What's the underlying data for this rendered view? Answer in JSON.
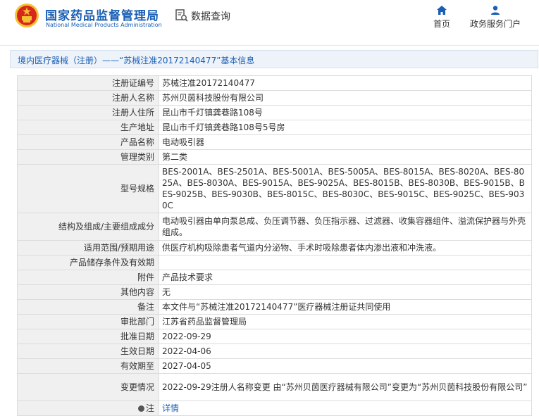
{
  "header": {
    "brand_cn": "国家药品监督管理局",
    "brand_en": "National Medical Products Administration",
    "query_label": "数据查询",
    "nav": {
      "home_label": "首页",
      "portal_label": "政务服务门户"
    }
  },
  "breadcrumb": {
    "text": "境内医疗器械（注册）——“苏械注准20172140477”基本信息"
  },
  "colors": {
    "brand_blue": "#1a5fb4",
    "label_bg": "#f0f0f0",
    "breadcrumb_bg": "#eef3fa",
    "emblem_red": "#d7261e",
    "emblem_gold": "#f2c230"
  },
  "icons": {
    "logo": "national-emblem-icon",
    "query": "document-search-icon",
    "home": "home-icon",
    "portal": "user-icon",
    "note": "info-dot-icon"
  },
  "table": {
    "rows": [
      {
        "label": "注册证编号",
        "value": "苏械注准20172140477"
      },
      {
        "label": "注册人名称",
        "value": "苏州贝茵科技股份有限公司"
      },
      {
        "label": "注册人住所",
        "value": "昆山市千灯镇龚巷路108号"
      },
      {
        "label": "生产地址",
        "value": "昆山市千灯镇龚巷路108号5号房"
      },
      {
        "label": "产品名称",
        "value": "电动吸引器"
      },
      {
        "label": "管理类别",
        "value": "第二类"
      },
      {
        "label": "型号规格",
        "value": "BES-2001A、BES-2501A、BES-5001A、BES-5005A、BES-8015A、BES-8020A、BES-8025A、BES-8030A、BES-9015A、BES-9025A、BES-8015B、BES-8030B、BES-9015B、BES-9025B、BES-9030B、BES-8015C、BES-8030C、BES-9015C、BES-9025C、BES-9030C"
      },
      {
        "label": "结构及组成/主要组成成分",
        "value": "电动吸引器由单向泵总成、负压调节器、负压指示器、过滤器、收集容器组件、溢流保护器与外壳组成。"
      },
      {
        "label": "适用范围/预期用途",
        "value": "供医疗机构吸除患者气道内分泌物、手术时吸除患者体内渗出液和冲洗液。"
      },
      {
        "label": "产品储存条件及有效期",
        "value": ""
      },
      {
        "label": "附件",
        "value": "产品技术要求"
      },
      {
        "label": "其他内容",
        "value": "无"
      },
      {
        "label": "备注",
        "value": "本文件与“苏械注准20172140477”医疗器械注册证共同使用"
      },
      {
        "label": "审批部门",
        "value": "江苏省药品监督管理局"
      },
      {
        "label": "批准日期",
        "value": "2022-09-29"
      },
      {
        "label": "生效日期",
        "value": "2022-04-06"
      },
      {
        "label": "有效期至",
        "value": "2027-04-05"
      },
      {
        "label": "变更情况",
        "value": "2022-09-29注册人名称变更 由“苏州贝茵医疗器械有限公司”变更为“苏州贝茵科技股份有限公司”"
      },
      {
        "label": "注",
        "value": "详情"
      }
    ]
  }
}
